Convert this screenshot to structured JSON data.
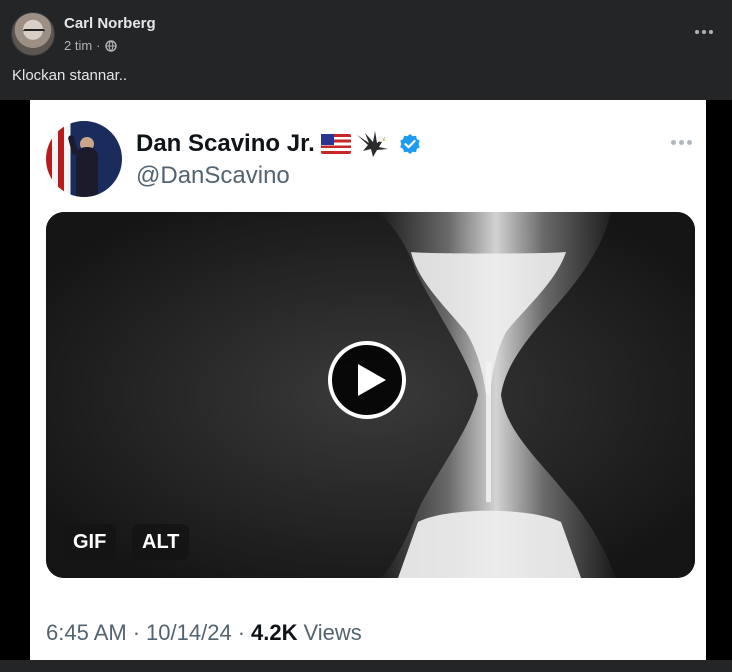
{
  "post": {
    "author": "Carl Norberg",
    "time": "2 tim",
    "separator": "·",
    "audience_icon": "globe-icon",
    "text": "Klockan stannar..",
    "menu_icon": "more-horizontal-icon"
  },
  "tweet": {
    "name": "Dan Scavino Jr.",
    "handle": "@DanScavino",
    "name_icons": [
      "us-flag-icon",
      "eagle-icon",
      "verified-badge-icon"
    ],
    "video": {
      "gif_label": "GIF",
      "alt_label": "ALT",
      "play_icon": "play-icon"
    },
    "timestamp": "6:45 AM",
    "date": "10/14/24",
    "sep1": "·",
    "sep2": "·",
    "views_count": "4.2K",
    "views_label": "Views"
  },
  "colors": {
    "facebook_bg": "#242526",
    "verified_blue": "#1d9bf0",
    "tweet_bg": "#ffffff"
  }
}
